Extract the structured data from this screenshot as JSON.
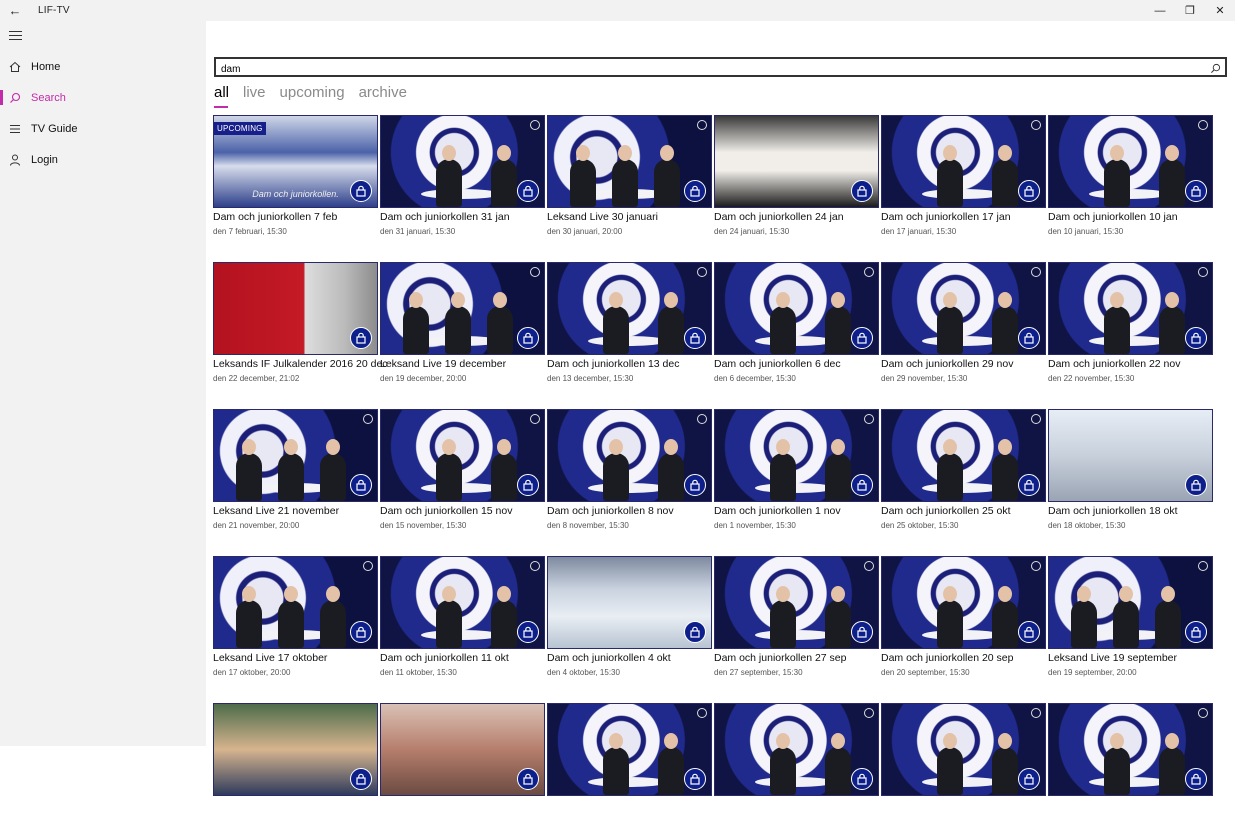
{
  "window": {
    "title": "LIF-TV",
    "back": "←",
    "minimize": "—",
    "restore": "❐",
    "close": "✕"
  },
  "sidebar": {
    "items": [
      {
        "label": "Home",
        "icon": "home-icon"
      },
      {
        "label": "Search",
        "icon": "search-icon",
        "active": true
      },
      {
        "label": "TV Guide",
        "icon": "list-icon"
      },
      {
        "label": "Login",
        "icon": "person-icon"
      }
    ]
  },
  "search": {
    "value": "dam",
    "placeholder": ""
  },
  "tabs": [
    {
      "label": "all",
      "active": true
    },
    {
      "label": "live"
    },
    {
      "label": "upcoming"
    },
    {
      "label": "archive"
    }
  ],
  "accent_color": "#c22ba9",
  "lock_color": "#0d1f8a",
  "videos": [
    {
      "title": "Dam och juniorkollen 7 feb",
      "date": "den 7 februari, 15:30",
      "badge": "UPCOMING",
      "caption": "Dam och juniorkollen.",
      "thumb": "team"
    },
    {
      "title": "Dam och juniorkollen 31 jan",
      "date": "den 31 januari, 15:30",
      "thumb": "studio"
    },
    {
      "title": "Leksand Live 30 januari",
      "date": "den 30 januari, 20:00",
      "thumb": "studio-a"
    },
    {
      "title": "Dam och juniorkollen 24 jan",
      "date": "den 24 januari, 15:30",
      "thumb": "dark"
    },
    {
      "title": "Dam och juniorkollen 17 jan",
      "date": "den 17 januari, 15:30",
      "thumb": "studio"
    },
    {
      "title": "Dam och juniorkollen 10 jan",
      "date": "den 10 januari, 15:30",
      "thumb": "studio"
    },
    {
      "title": "Leksands IF Julkalender 2016 20 dec",
      "date": "den 22 december, 21:02",
      "thumb": "red"
    },
    {
      "title": "Leksand Live 19 december",
      "date": "den 19 december, 20:00",
      "thumb": "studio-a"
    },
    {
      "title": "Dam och juniorkollen 13 dec",
      "date": "den 13 december, 15:30",
      "thumb": "studio"
    },
    {
      "title": "Dam och juniorkollen 6 dec",
      "date": "den 6 december, 15:30",
      "thumb": "studio"
    },
    {
      "title": "Dam och juniorkollen 29 nov",
      "date": "den 29 november, 15:30",
      "thumb": "studio"
    },
    {
      "title": "Dam och juniorkollen 22 nov",
      "date": "den 22 november, 15:30",
      "thumb": "studio"
    },
    {
      "title": "Leksand Live 21 november",
      "date": "den 21 november, 20:00",
      "thumb": "studio-a"
    },
    {
      "title": "Dam och juniorkollen 15 nov",
      "date": "den 15 november, 15:30",
      "thumb": "studio"
    },
    {
      "title": "Dam och juniorkollen 8 nov",
      "date": "den 8 november, 15:30",
      "thumb": "studio"
    },
    {
      "title": "Dam och juniorkollen 1 nov",
      "date": "den 1 november, 15:30",
      "thumb": "studio"
    },
    {
      "title": "Dam och juniorkollen 25 okt",
      "date": "den 25 oktober, 15:30",
      "thumb": "studio"
    },
    {
      "title": "Dam och juniorkollen 18 okt",
      "date": "den 18 oktober, 15:30",
      "thumb": "bright"
    },
    {
      "title": "Leksand Live 17 oktober",
      "date": "den 17 oktober, 20:00",
      "thumb": "studio-a"
    },
    {
      "title": "Dam och juniorkollen 11 okt",
      "date": "den 11 oktober, 15:30",
      "thumb": "studio"
    },
    {
      "title": "Dam och juniorkollen 4 okt",
      "date": "den 4 oktober, 15:30",
      "thumb": "ice"
    },
    {
      "title": "Dam och juniorkollen 27 sep",
      "date": "den 27 september, 15:30",
      "thumb": "studio"
    },
    {
      "title": "Dam och juniorkollen 20 sep",
      "date": "den 20 september, 15:30",
      "thumb": "studio"
    },
    {
      "title": "Leksand Live 19 september",
      "date": "den 19 september, 20:00",
      "thumb": "studio-a"
    },
    {
      "title": "",
      "date": "",
      "thumb": "mixed"
    },
    {
      "title": "",
      "date": "",
      "thumb": "pink"
    },
    {
      "title": "",
      "date": "",
      "thumb": "studio"
    },
    {
      "title": "",
      "date": "",
      "thumb": "studio"
    },
    {
      "title": "",
      "date": "",
      "thumb": "studio"
    },
    {
      "title": "",
      "date": "",
      "thumb": "studio"
    }
  ]
}
